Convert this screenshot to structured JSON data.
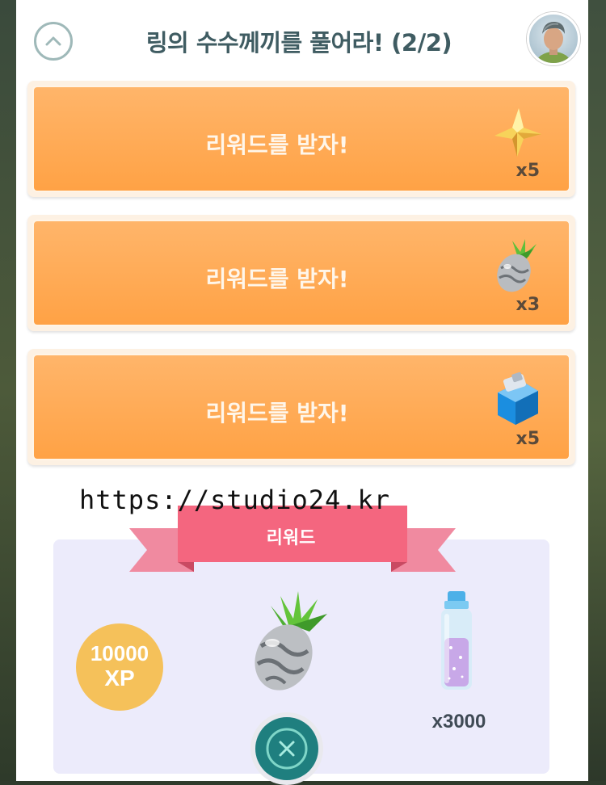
{
  "header": {
    "title": "링의 수수께끼를 풀어라! (2/2)"
  },
  "tasks": [
    {
      "label": "리워드를 받자!",
      "reward_icon": "star-piece-icon",
      "count": "x5"
    },
    {
      "label": "리워드를 받자!",
      "reward_icon": "silver-pinap-berry-icon",
      "count": "x3"
    },
    {
      "label": "리워드를 받자!",
      "reward_icon": "incense-icon",
      "count": "x5"
    }
  ],
  "watermark": "https://studio24.kr",
  "rewards": {
    "banner_label": "리워드",
    "xp_amount": "10000",
    "xp_unit": "XP",
    "berry_icon": "silver-pinap-berry-icon",
    "stardust_icon": "stardust-vial-icon",
    "stardust_count": "x3000"
  },
  "colors": {
    "task_orange": "#ffa245",
    "title_teal": "#3f5c62",
    "ribbon_pink": "#f4667f",
    "xp_gold": "#f5c15a",
    "reward_bg": "#ecebfb",
    "close_teal": "#1f7f7f"
  }
}
